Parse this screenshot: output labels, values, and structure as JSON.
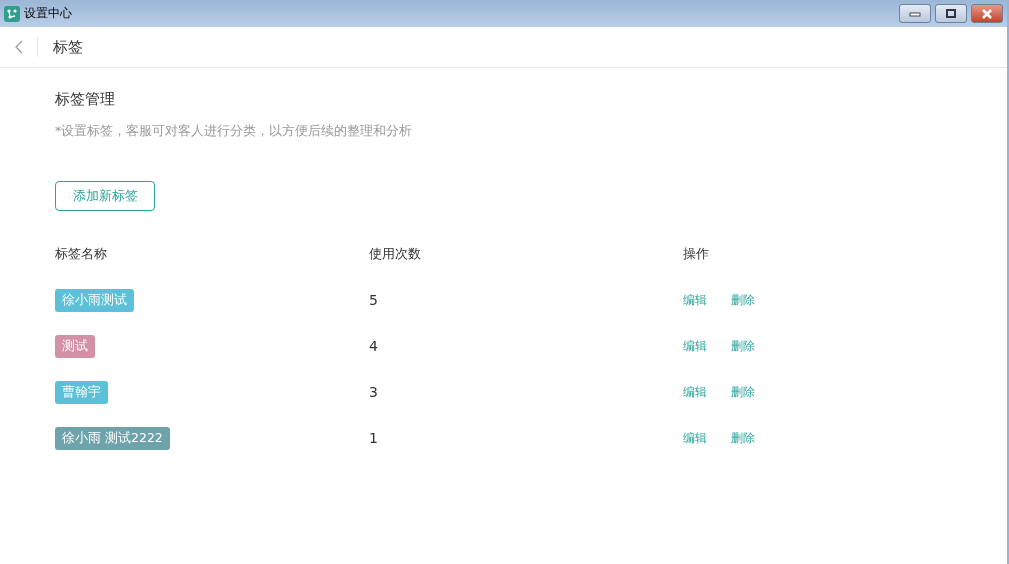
{
  "window": {
    "title": "设置中心"
  },
  "header": {
    "title": "标签"
  },
  "section": {
    "title": "标签管理",
    "hint": "*设置标签，客服可对客人进行分类，以方便后续的整理和分析",
    "add_button": "添加新标签"
  },
  "table": {
    "columns": [
      "标签名称",
      "使用次数",
      "操作"
    ],
    "rows": [
      {
        "tag": "徐小雨测试",
        "color": "#5bc0d8",
        "count": "5",
        "actions": [
          "编辑",
          "删除"
        ]
      },
      {
        "tag": "测试",
        "color": "#d490a6",
        "count": "4",
        "actions": [
          "编辑",
          "删除"
        ]
      },
      {
        "tag": "曹翰宇",
        "color": "#5bc0d8",
        "count": "3",
        "actions": [
          "编辑",
          "删除"
        ]
      },
      {
        "tag": "徐小雨 测试2222",
        "color": "#6ea3ab",
        "count": "1",
        "actions": [
          "编辑",
          "删除"
        ]
      }
    ]
  }
}
